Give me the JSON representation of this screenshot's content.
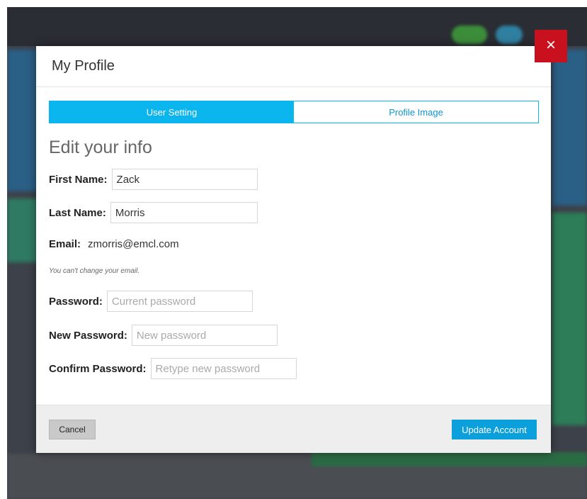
{
  "modal": {
    "title": "My Profile",
    "close_icon": "×"
  },
  "tabs": [
    {
      "label": "User Setting",
      "active": true
    },
    {
      "label": "Profile Image",
      "active": false
    }
  ],
  "form": {
    "section_title": "Edit your info",
    "first_name": {
      "label": "First Name:",
      "value": "Zack"
    },
    "last_name": {
      "label": "Last Name:",
      "value": "Morris"
    },
    "email": {
      "label": "Email:",
      "value": "zmorris@emcl.com",
      "note": "You can't change your email."
    },
    "password": {
      "label": "Password:",
      "placeholder": "Current password"
    },
    "new_password": {
      "label": "New Password:",
      "placeholder": "New password"
    },
    "confirm_password": {
      "label": "Confirm Password:",
      "placeholder": "Retype new password"
    }
  },
  "footer": {
    "cancel_label": "Cancel",
    "update_label": "Update Account"
  },
  "colors": {
    "accent": "#0bb5ee",
    "close": "#c8101e",
    "primary_button": "#0b9fdc"
  }
}
